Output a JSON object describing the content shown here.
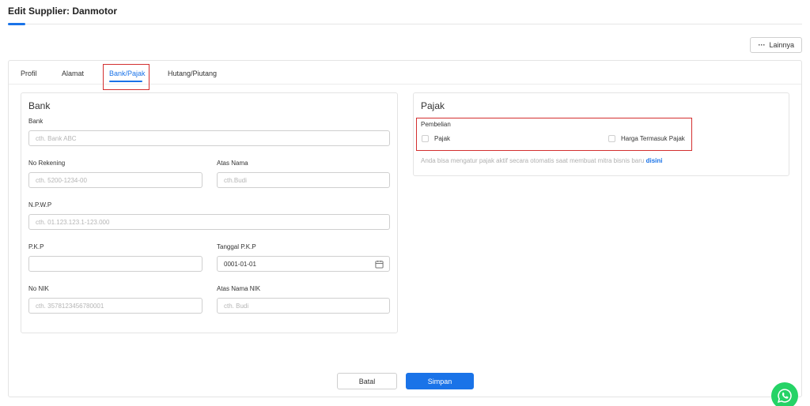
{
  "header": {
    "title": "Edit Supplier: Danmotor"
  },
  "more_button": {
    "label": "Lainnya",
    "dots": "···"
  },
  "tabs": [
    {
      "label": "Profil"
    },
    {
      "label": "Alamat"
    },
    {
      "label": "Bank/Pajak"
    },
    {
      "label": "Hutang/Piutang"
    }
  ],
  "bank": {
    "title": "Bank",
    "bank_label": "Bank",
    "bank_placeholder": "cth. Bank ABC",
    "account_label": "No Rekening",
    "account_placeholder": "cth. 5200-1234-00",
    "account_name_label": "Atas Nama",
    "account_name_placeholder": "cth.Budi",
    "npwp_label": "N.P.W.P",
    "npwp_placeholder": "cth. 01.123.123.1-123.000",
    "pkp_label": "P.K.P",
    "pkp_value": "",
    "pkp_date_label": "Tanggal P.K.P",
    "pkp_date_value": "0001-01-01",
    "nik_label": "No NIK",
    "nik_placeholder": "cth. 3578123456780001",
    "nik_name_label": "Atas Nama NIK",
    "nik_name_placeholder": "cth. Budi"
  },
  "tax": {
    "title": "Pajak",
    "purchase_label": "Pembelian",
    "tax_checkbox_label": "Pajak",
    "price_incl_tax_label": "Harga Termasuk Pajak",
    "hint_text": "Anda bisa mengatur pajak aktif secara otomatis saat membuat mitra bisnis baru",
    "hint_link": "disini"
  },
  "actions": {
    "cancel_label": "Batal",
    "save_label": "Simpan"
  },
  "colors": {
    "accent": "#1a73e8",
    "highlight": "#d32f2f",
    "whatsapp": "#25d366"
  }
}
